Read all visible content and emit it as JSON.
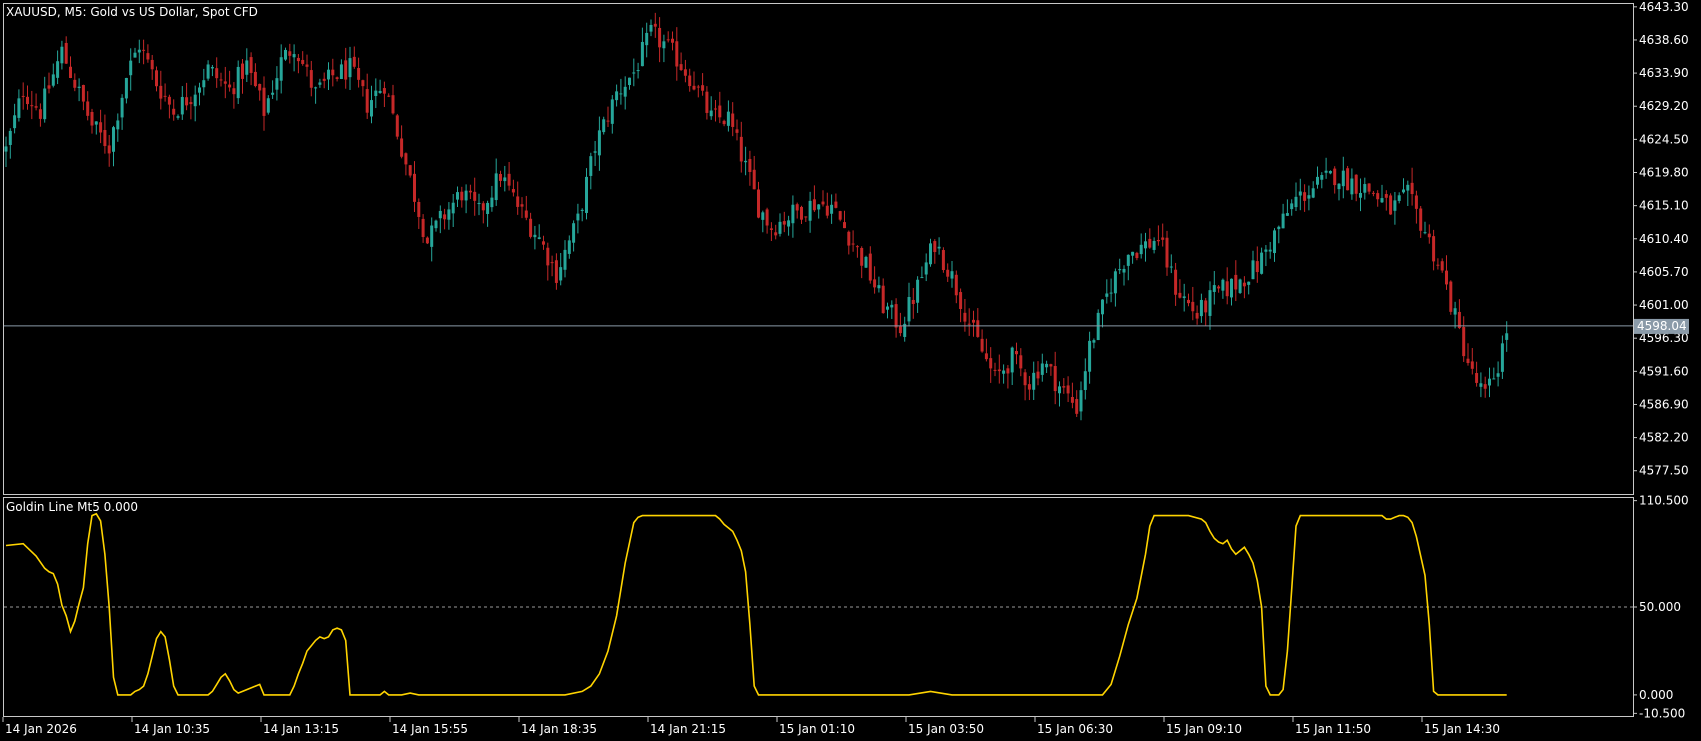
{
  "colors": {
    "background": "#000000",
    "frame": "#c8c8c8",
    "bull": "#26a69a",
    "bear": "#c62828",
    "wick_bull": "#26a69a",
    "wick_bear": "#c62828",
    "bid_line": "#8a9aa8",
    "bid_label_bg": "#8a9aa8",
    "indicator_line": "#ffd400",
    "level_line": "#9a9a9a",
    "text": "#ffffff"
  },
  "price_panel": {
    "title": "XAUUSD, M5:  Gold vs US Dollar, Spot CFD",
    "ymin": 4574.2,
    "ymax": 4643.7,
    "ticks": [
      "4643.30",
      "4638.60",
      "4633.90",
      "4629.20",
      "4624.50",
      "4619.80",
      "4615.10",
      "4610.40",
      "4605.70",
      "4601.00",
      "4596.30",
      "4591.60",
      "4586.90",
      "4582.20",
      "4577.50"
    ],
    "bid_price": 4598.04,
    "bid_label": "4598.04"
  },
  "indicator_panel": {
    "title": "Goldin Line Mt5 0.000",
    "ymin": -12,
    "ymax": 112,
    "ticks": [
      "110.500",
      "50.000",
      "0.000",
      "-10.500"
    ],
    "level": 50
  },
  "time_axis": {
    "labels": [
      "14 Jan 2026",
      "14 Jan 10:35",
      "14 Jan 13:15",
      "14 Jan 15:55",
      "14 Jan 18:35",
      "14 Jan 21:15",
      "15 Jan 01:10",
      "15 Jan 03:50",
      "15 Jan 06:30",
      "15 Jan 09:10",
      "15 Jan 11:50",
      "15 Jan 14:30"
    ]
  },
  "chart_data": [
    {
      "type": "candlestick",
      "title": "XAUUSD, M5:  Gold vs US Dollar, Spot CFD",
      "timeframe": "M5",
      "x_labels": [
        "14 Jan 2026",
        "14 Jan 10:35",
        "14 Jan 13:15",
        "14 Jan 15:55",
        "14 Jan 18:35",
        "14 Jan 21:15",
        "15 Jan 01:10",
        "15 Jan 03:50",
        "15 Jan 06:30",
        "15 Jan 09:10",
        "15 Jan 11:50",
        "15 Jan 14:30"
      ],
      "ylim": [
        4574.2,
        4643.7
      ],
      "close_path": [
        [
          0,
          4623.0
        ],
        [
          4,
          4631.5
        ],
        [
          8,
          4628.5
        ],
        [
          13,
          4637.0
        ],
        [
          16,
          4632.5
        ],
        [
          20,
          4626.5
        ],
        [
          24,
          4623.5
        ],
        [
          28,
          4633.5
        ],
        [
          31,
          4638.0
        ],
        [
          35,
          4632.5
        ],
        [
          39,
          4628.5
        ],
        [
          43,
          4630.8
        ],
        [
          47,
          4634.5
        ],
        [
          52,
          4631.5
        ],
        [
          56,
          4635.0
        ],
        [
          60,
          4628.5
        ],
        [
          64,
          4635.5
        ],
        [
          67,
          4638.0
        ],
        [
          72,
          4631.0
        ],
        [
          76,
          4633.5
        ],
        [
          80,
          4634.5
        ],
        [
          84,
          4629.5
        ],
        [
          88,
          4632.5
        ],
        [
          93,
          4621.0
        ],
        [
          98,
          4610.0
        ],
        [
          101,
          4613.0
        ],
        [
          106,
          4617.0
        ],
        [
          110,
          4614.0
        ],
        [
          115,
          4619.5
        ],
        [
          120,
          4614.0
        ],
        [
          124,
          4610.5
        ],
        [
          128,
          4605.5
        ],
        [
          133,
          4613.0
        ],
        [
          137,
          4623.5
        ],
        [
          142,
          4631.0
        ],
        [
          146,
          4634.0
        ],
        [
          150,
          4639.5
        ],
        [
          153,
          4638.0
        ],
        [
          156,
          4636.0
        ],
        [
          160,
          4632.5
        ],
        [
          164,
          4627.5
        ],
        [
          168,
          4627.5
        ],
        [
          172,
          4620.5
        ],
        [
          175,
          4615.0
        ],
        [
          178,
          4612.0
        ],
        [
          183,
          4614.0
        ],
        [
          188,
          4615.5
        ],
        [
          192,
          4615.0
        ],
        [
          196,
          4611.0
        ],
        [
          200,
          4606.5
        ],
        [
          204,
          4601.0
        ],
        [
          208,
          4598.0
        ],
        [
          212,
          4603.5
        ],
        [
          216,
          4610.0
        ],
        [
          220,
          4605.0
        ],
        [
          225,
          4597.0
        ],
        [
          230,
          4590.5
        ],
        [
          234,
          4593.5
        ],
        [
          238,
          4590.0
        ],
        [
          241,
          4593.0
        ],
        [
          245,
          4589.5
        ],
        [
          249,
          4586.5
        ],
        [
          252,
          4595.0
        ],
        [
          257,
          4604.0
        ],
        [
          261,
          4608.5
        ],
        [
          265,
          4609.5
        ],
        [
          268,
          4610.5
        ],
        [
          272,
          4603.5
        ],
        [
          277,
          4599.5
        ],
        [
          281,
          4602.5
        ],
        [
          286,
          4604.0
        ],
        [
          291,
          4606.5
        ],
        [
          295,
          4611.0
        ],
        [
          300,
          4616.0
        ],
        [
          305,
          4618.0
        ],
        [
          309,
          4619.5
        ],
        [
          313,
          4618.5
        ],
        [
          318,
          4617.0
        ],
        [
          322,
          4614.5
        ],
        [
          326,
          4616.5
        ],
        [
          330,
          4611.5
        ],
        [
          334,
          4605.5
        ],
        [
          338,
          4597.0
        ],
        [
          341,
          4591.0
        ],
        [
          344,
          4588.0
        ],
        [
          347,
          4592.5
        ],
        [
          349,
          4597.5
        ]
      ]
    },
    {
      "type": "line",
      "title": "Goldin Line Mt5 0.000",
      "ylim": [
        -10.5,
        110.5
      ],
      "levels": [
        50
      ],
      "points": [
        [
          0,
          85
        ],
        [
          4,
          86
        ],
        [
          7,
          79
        ],
        [
          9,
          72
        ],
        [
          10,
          70
        ],
        [
          11,
          69
        ],
        [
          12,
          63
        ],
        [
          13,
          51
        ],
        [
          14,
          45
        ],
        [
          15,
          36
        ],
        [
          16,
          42
        ],
        [
          17,
          52
        ],
        [
          18,
          61
        ],
        [
          19,
          86
        ],
        [
          20,
          102
        ],
        [
          21,
          103
        ],
        [
          22,
          99
        ],
        [
          23,
          80
        ],
        [
          24,
          50
        ],
        [
          25,
          10
        ],
        [
          26,
          0
        ],
        [
          27,
          0
        ],
        [
          28,
          0
        ],
        [
          29,
          0
        ],
        [
          30,
          2
        ],
        [
          31,
          3
        ],
        [
          32,
          5
        ],
        [
          33,
          12
        ],
        [
          34,
          22
        ],
        [
          35,
          32
        ],
        [
          36,
          36
        ],
        [
          37,
          33
        ],
        [
          38,
          20
        ],
        [
          39,
          5
        ],
        [
          40,
          0
        ],
        [
          41,
          0
        ],
        [
          42,
          0
        ],
        [
          43,
          0
        ],
        [
          44,
          0
        ],
        [
          45,
          0
        ],
        [
          46,
          0
        ],
        [
          47,
          0
        ],
        [
          48,
          2
        ],
        [
          49,
          6
        ],
        [
          50,
          10
        ],
        [
          51,
          12
        ],
        [
          52,
          8
        ],
        [
          53,
          3
        ],
        [
          54,
          1
        ],
        [
          55,
          2
        ],
        [
          56,
          3
        ],
        [
          57,
          4
        ],
        [
          58,
          5
        ],
        [
          59,
          6
        ],
        [
          60,
          0
        ],
        [
          61,
          0
        ],
        [
          62,
          0
        ],
        [
          63,
          0
        ],
        [
          64,
          0
        ],
        [
          65,
          0
        ],
        [
          66,
          0
        ],
        [
          67,
          5
        ],
        [
          68,
          12
        ],
        [
          69,
          18
        ],
        [
          70,
          25
        ],
        [
          71,
          28
        ],
        [
          72,
          31
        ],
        [
          73,
          33
        ],
        [
          74,
          32
        ],
        [
          75,
          33
        ],
        [
          76,
          37
        ],
        [
          77,
          38
        ],
        [
          78,
          37
        ],
        [
          79,
          31
        ],
        [
          80,
          0
        ],
        [
          81,
          0
        ],
        [
          82,
          0
        ],
        [
          83,
          0
        ],
        [
          84,
          0
        ],
        [
          85,
          0
        ],
        [
          86,
          0
        ],
        [
          87,
          0
        ],
        [
          88,
          2
        ],
        [
          89,
          0
        ],
        [
          90,
          0
        ],
        [
          92,
          0
        ],
        [
          94,
          1
        ],
        [
          96,
          0
        ],
        [
          100,
          0
        ],
        [
          110,
          0
        ],
        [
          120,
          0
        ],
        [
          130,
          0
        ],
        [
          134,
          2
        ],
        [
          136,
          5
        ],
        [
          138,
          12
        ],
        [
          140,
          25
        ],
        [
          142,
          45
        ],
        [
          144,
          75
        ],
        [
          146,
          98
        ],
        [
          147,
          101
        ],
        [
          148,
          102
        ],
        [
          165,
          102
        ],
        [
          166,
          100
        ],
        [
          167,
          97
        ],
        [
          168,
          95
        ],
        [
          169,
          93
        ],
        [
          170,
          88
        ],
        [
          171,
          82
        ],
        [
          172,
          70
        ],
        [
          173,
          40
        ],
        [
          174,
          5
        ],
        [
          175,
          0
        ],
        [
          190,
          0
        ],
        [
          200,
          0
        ],
        [
          210,
          0
        ],
        [
          215,
          2
        ],
        [
          220,
          0
        ],
        [
          240,
          0
        ],
        [
          255,
          0
        ],
        [
          257,
          6
        ],
        [
          259,
          22
        ],
        [
          261,
          40
        ],
        [
          263,
          55
        ],
        [
          265,
          80
        ],
        [
          266,
          96
        ],
        [
          267,
          102
        ],
        [
          275,
          102
        ],
        [
          278,
          100
        ],
        [
          279,
          98
        ],
        [
          280,
          93
        ],
        [
          281,
          89
        ],
        [
          282,
          87
        ],
        [
          283,
          86
        ],
        [
          284,
          88
        ],
        [
          285,
          83
        ],
        [
          286,
          80
        ],
        [
          287,
          82
        ],
        [
          288,
          84
        ],
        [
          289,
          80
        ],
        [
          290,
          75
        ],
        [
          291,
          65
        ],
        [
          292,
          50
        ],
        [
          293,
          5
        ],
        [
          294,
          0
        ],
        [
          295,
          0
        ],
        [
          296,
          0
        ],
        [
          297,
          3
        ],
        [
          298,
          25
        ],
        [
          299,
          60
        ],
        [
          300,
          96
        ],
        [
          301,
          102
        ],
        [
          320,
          102
        ],
        [
          321,
          100
        ],
        [
          322,
          100
        ],
        [
          323,
          101
        ],
        [
          324,
          102
        ],
        [
          325,
          102
        ],
        [
          326,
          101
        ],
        [
          327,
          98
        ],
        [
          328,
          90
        ],
        [
          330,
          68
        ],
        [
          331,
          40
        ],
        [
          332,
          2
        ],
        [
          333,
          0
        ],
        [
          349,
          0
        ]
      ]
    }
  ]
}
